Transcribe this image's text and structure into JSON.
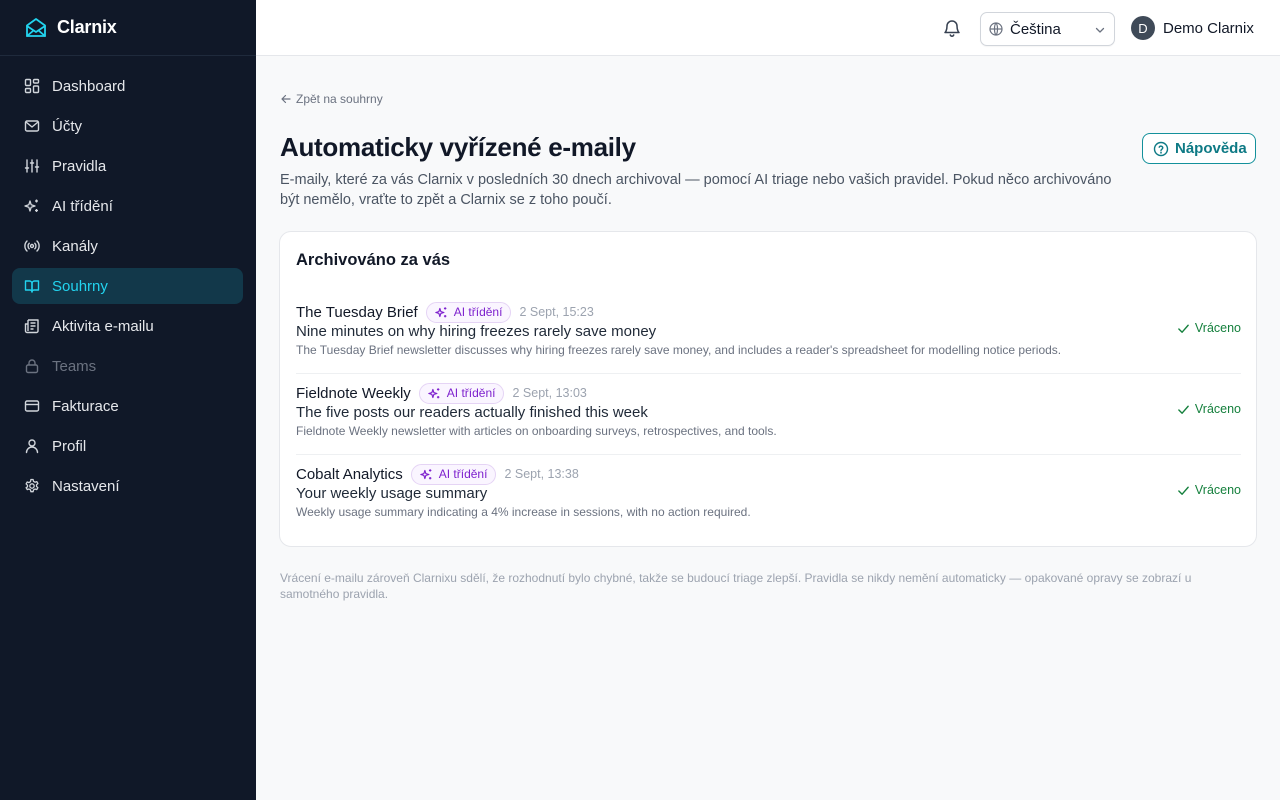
{
  "app": {
    "name": "Clarnix"
  },
  "sidebar": {
    "items": [
      {
        "label": "Dashboard",
        "icon": "dashboard-icon",
        "state": "normal"
      },
      {
        "label": "Účty",
        "icon": "mail-icon",
        "state": "normal"
      },
      {
        "label": "Pravidla",
        "icon": "sliders-icon",
        "state": "normal"
      },
      {
        "label": "AI třídění",
        "icon": "sparkles-icon",
        "state": "normal"
      },
      {
        "label": "Kanály",
        "icon": "radio-icon",
        "state": "normal"
      },
      {
        "label": "Souhrny",
        "icon": "book-open-icon",
        "state": "active"
      },
      {
        "label": "Aktivita e-mailu",
        "icon": "newspaper-icon",
        "state": "normal"
      },
      {
        "label": "Teams",
        "icon": "lock-icon",
        "state": "disabled"
      },
      {
        "label": "Fakturace",
        "icon": "credit-card-icon",
        "state": "normal"
      },
      {
        "label": "Profil",
        "icon": "user-icon",
        "state": "normal"
      },
      {
        "label": "Nastavení",
        "icon": "gear-icon",
        "state": "normal"
      }
    ]
  },
  "header": {
    "language": "Čeština",
    "user_initial": "D",
    "user_name": "Demo Clarnix"
  },
  "main": {
    "back_link": "Zpět na souhrny",
    "title": "Automaticky vyřízené e-maily",
    "description": "E-maily, které za vás Clarnix v posledních 30 dnech archivoval — pomocí AI triage nebo vašich pravidel. Pokud něco archivováno být nemělo, vraťte to zpět a Clarnix se z toho poučí.",
    "help_button": "Nápověda",
    "card_title": "Archivováno za vás",
    "emails": [
      {
        "sender": "The Tuesday Brief",
        "badge": "AI třídění",
        "date": "2 Sept, 15:23",
        "subject": "Nine minutes on why hiring freezes rarely save money",
        "summary": "The Tuesday Brief newsletter discusses why hiring freezes rarely save money, and includes a reader's spreadsheet for modelling notice periods.",
        "status": "Vráceno"
      },
      {
        "sender": "Fieldnote Weekly",
        "badge": "AI třídění",
        "date": "2 Sept, 13:03",
        "subject": "The five posts our readers actually finished this week",
        "summary": "Fieldnote Weekly newsletter with articles on onboarding surveys, retrospectives, and tools.",
        "status": "Vráceno"
      },
      {
        "sender": "Cobalt Analytics",
        "badge": "AI třídění",
        "date": "2 Sept, 13:38",
        "subject": "Your weekly usage summary",
        "summary": "Weekly usage summary indicating a 4% increase in sessions, with no action required.",
        "status": "Vráceno"
      }
    ],
    "footnote": "Vrácení e-mailu zároveň Clarnixu sdělí, že rozhodnutí bylo chybné, takže se budoucí triage zlepší. Pravidla se nikdy nemění automaticky — opakované opravy se zobrazí u samotného pravidla."
  },
  "colors": {
    "sidebar_bg": "#101828",
    "active_bg": "#12384a",
    "accent": "#22d3ee",
    "help_teal": "#0e7a85",
    "badge_purple": "#7e22ce",
    "success_green": "#15803d"
  }
}
